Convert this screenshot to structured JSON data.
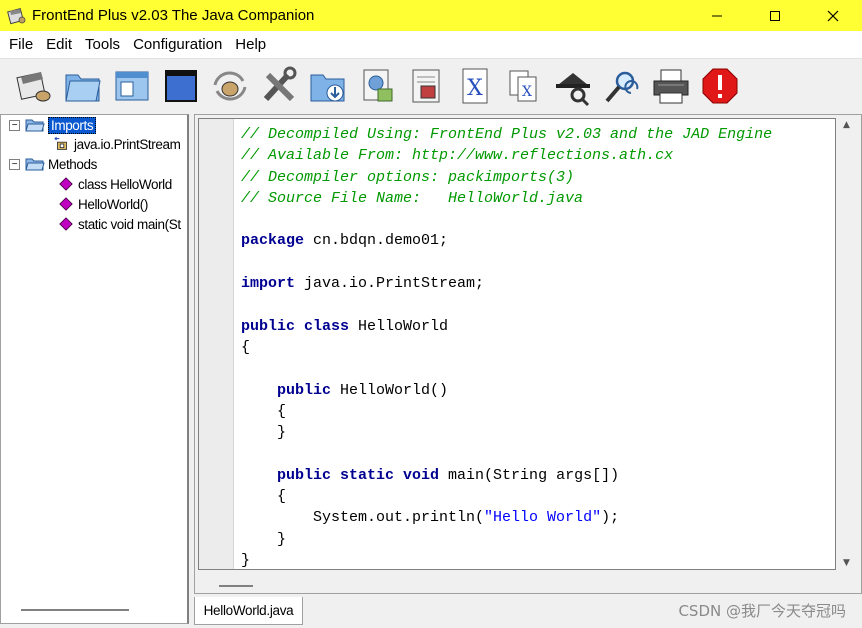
{
  "window": {
    "title": "FrontEnd Plus v2.03 The Java Companion"
  },
  "menu": [
    "File",
    "Edit",
    "Tools",
    "Configuration",
    "Help"
  ],
  "toolbar": {
    "icons": [
      "decompile-icon",
      "open-folder-icon",
      "open-window-icon",
      "blank-window-icon",
      "java-cup-icon",
      "tools-icon",
      "save-folder-icon",
      "export-doc-icon",
      "view-doc-icon",
      "java-file-icon",
      "class-file-icon",
      "detective-icon",
      "search-replace-icon",
      "print-icon",
      "stop-icon"
    ]
  },
  "tree": {
    "imports_label": "Imports",
    "import_item": "java.io.PrintStream",
    "methods_label": "Methods",
    "method_items": [
      "class HelloWorld",
      "HelloWorld()",
      "static void main(St"
    ]
  },
  "code": {
    "lines": [
      {
        "type": "comment",
        "text": "// Decompiled Using: FrontEnd Plus v2.03 and the JAD Engine"
      },
      {
        "type": "comment",
        "text": "// Available From: http://www.reflections.ath.cx"
      },
      {
        "type": "comment",
        "text": "// Decompiler options: packimports(3)"
      },
      {
        "type": "comment",
        "text": "// Source File Name:   HelloWorld.java"
      },
      {
        "type": "blank",
        "text": ""
      },
      {
        "type": "package",
        "kw": "package",
        "rest": " cn.bdqn.demo01;"
      },
      {
        "type": "blank",
        "text": ""
      },
      {
        "type": "import",
        "kw": "import",
        "rest": " java.io.PrintStream;"
      },
      {
        "type": "blank",
        "text": ""
      },
      {
        "type": "class",
        "kw": "public class",
        "rest": " HelloWorld"
      },
      {
        "type": "plain",
        "text": "{"
      },
      {
        "type": "blank",
        "text": ""
      },
      {
        "type": "ctor",
        "indent": "    ",
        "kw": "public",
        "rest": " HelloWorld()"
      },
      {
        "type": "plain",
        "text": "    {"
      },
      {
        "type": "plain",
        "text": "    }"
      },
      {
        "type": "blank",
        "text": ""
      },
      {
        "type": "main",
        "indent": "    ",
        "kw": "public static void",
        "rest": " main(String args[])"
      },
      {
        "type": "plain",
        "text": "    {"
      },
      {
        "type": "println",
        "pre": "        System.out.println(",
        "str": "\"Hello World\"",
        "post": ");"
      },
      {
        "type": "plain",
        "text": "    }"
      },
      {
        "type": "plain",
        "text": "}"
      }
    ]
  },
  "tabs": [
    "HelloWorld.java"
  ],
  "watermark": "CSDN @我厂今天夺冠吗",
  "colors": {
    "titlebar": "#ffff33",
    "comment": "#009900",
    "keyword": "#000090",
    "string": "#0000ff",
    "selection": "#0a58d0"
  }
}
